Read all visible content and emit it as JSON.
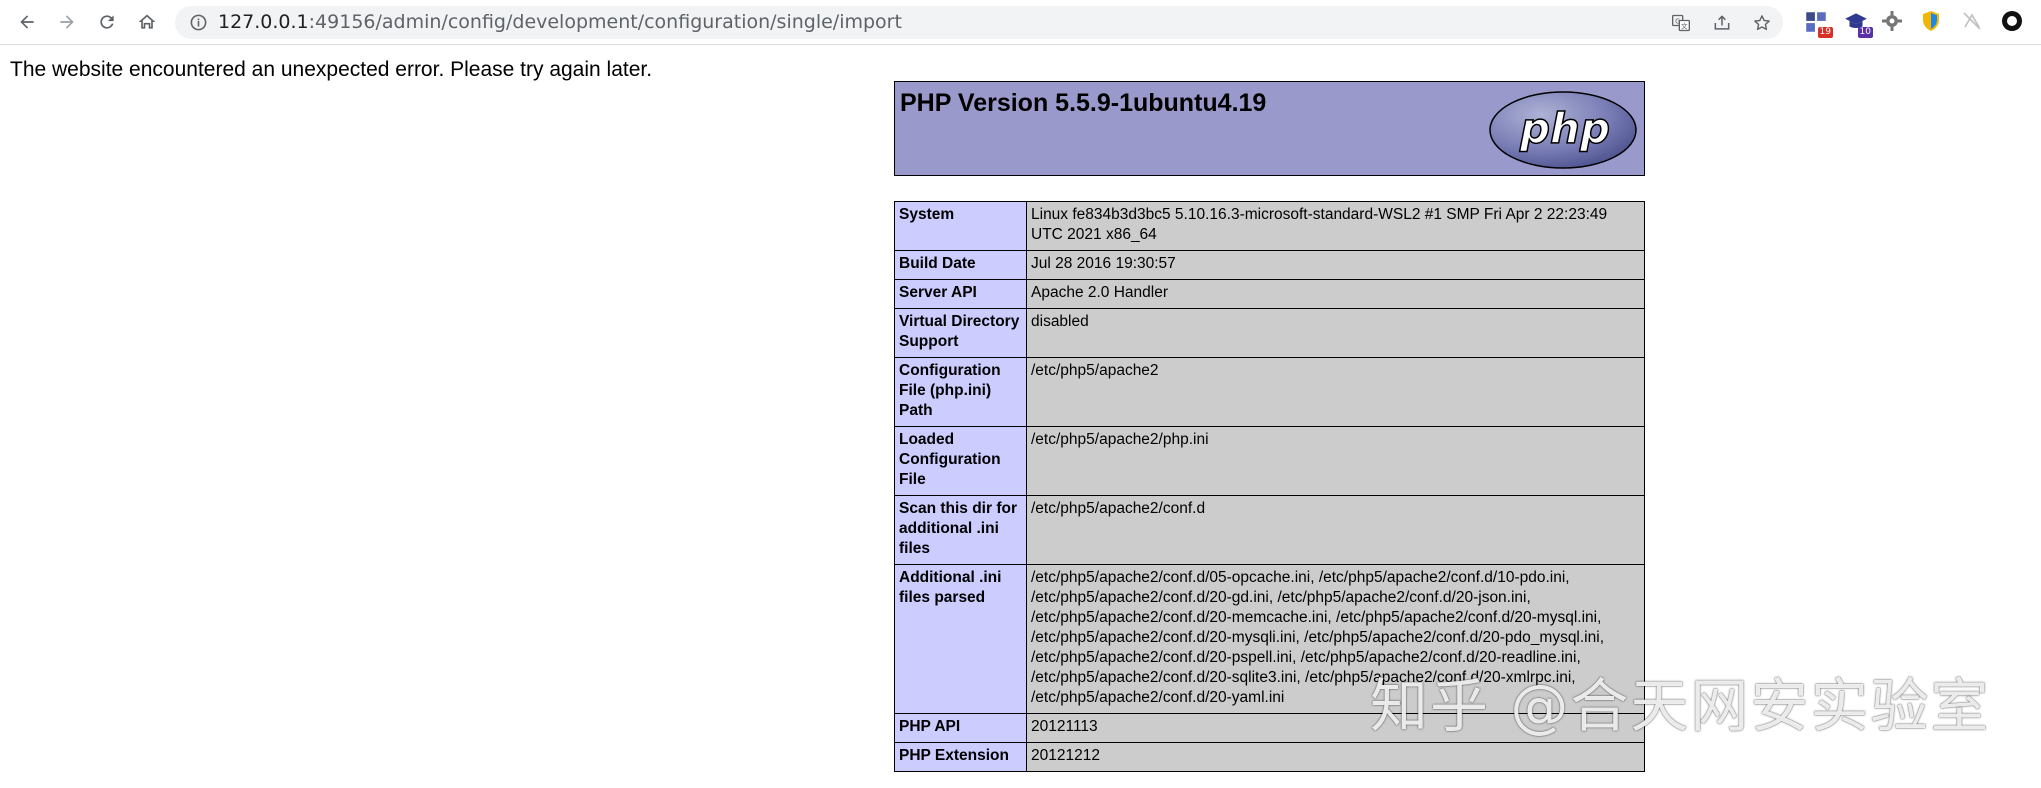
{
  "browser": {
    "url_host": "127.0.0.1",
    "url_rest": ":49156/admin/config/development/configuration/single/import",
    "extensions": [
      {
        "name": "extension-1",
        "badge": "19",
        "badge_color": "#d93025"
      },
      {
        "name": "extension-2",
        "badge": "10",
        "badge_color": "#5b2fa6"
      }
    ]
  },
  "page": {
    "error_message": "The website encountered an unexpected error. Please try again later."
  },
  "phpinfo": {
    "version_title": "PHP Version 5.5.9-1ubuntu4.19",
    "logo_text": "php",
    "rows": [
      {
        "label": "System",
        "value": "Linux fe834b3d3bc5 5.10.16.3-microsoft-standard-WSL2 #1 SMP Fri Apr 2 22:23:49 UTC 2021 x86_64"
      },
      {
        "label": "Build Date",
        "value": "Jul 28 2016 19:30:57"
      },
      {
        "label": "Server API",
        "value": "Apache 2.0 Handler"
      },
      {
        "label": "Virtual Directory Support",
        "value": "disabled"
      },
      {
        "label": "Configuration File (php.ini) Path",
        "value": "/etc/php5/apache2"
      },
      {
        "label": "Loaded Configuration File",
        "value": "/etc/php5/apache2/php.ini"
      },
      {
        "label": "Scan this dir for additional .ini files",
        "value": "/etc/php5/apache2/conf.d"
      },
      {
        "label": "Additional .ini files parsed",
        "value": "/etc/php5/apache2/conf.d/05-opcache.ini, /etc/php5/apache2/conf.d/10-pdo.ini, /etc/php5/apache2/conf.d/20-gd.ini, /etc/php5/apache2/conf.d/20-json.ini, /etc/php5/apache2/conf.d/20-memcache.ini, /etc/php5/apache2/conf.d/20-mysql.ini, /etc/php5/apache2/conf.d/20-mysqli.ini, /etc/php5/apache2/conf.d/20-pdo_mysql.ini, /etc/php5/apache2/conf.d/20-pspell.ini, /etc/php5/apache2/conf.d/20-readline.ini, /etc/php5/apache2/conf.d/20-sqlite3.ini, /etc/php5/apache2/conf.d/20-xmlrpc.ini, /etc/php5/apache2/conf.d/20-yaml.ini"
      },
      {
        "label": "PHP API",
        "value": "20121113"
      },
      {
        "label": "PHP Extension",
        "value": "20121212"
      }
    ]
  },
  "watermark": "知乎 @合天网安实验室"
}
